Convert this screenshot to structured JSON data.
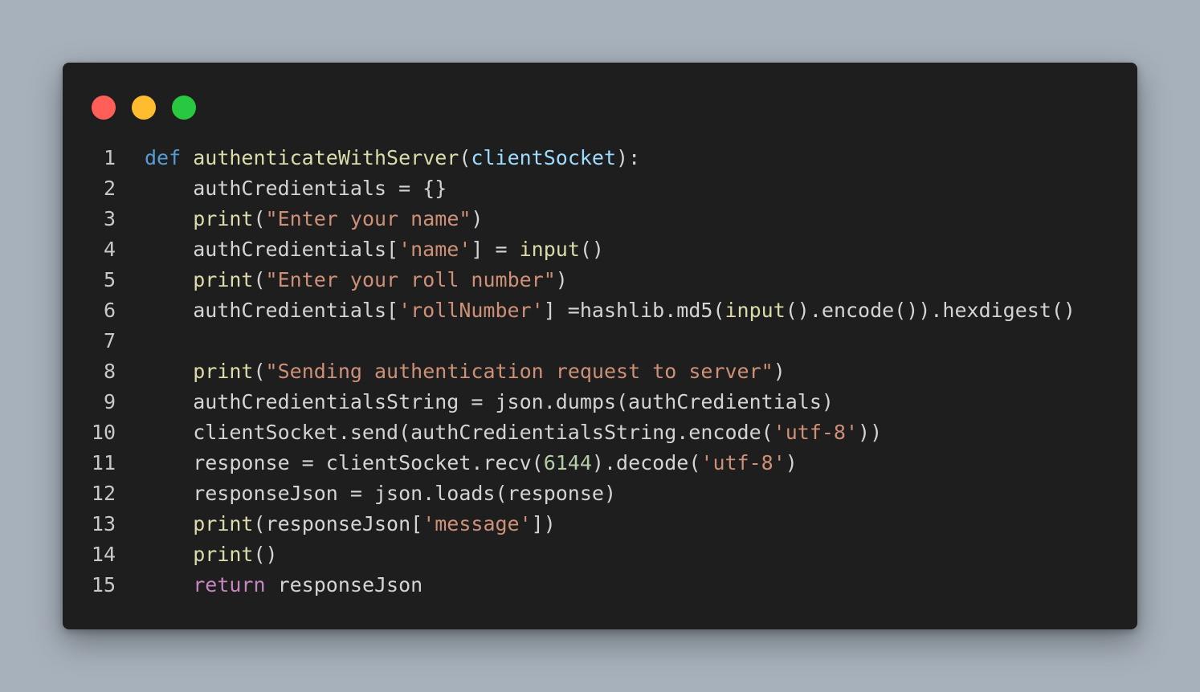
{
  "window": {
    "controls": [
      {
        "name": "close",
        "color": "#ff5f57"
      },
      {
        "name": "minimize",
        "color": "#febc2e"
      },
      {
        "name": "maximize",
        "color": "#28c840"
      }
    ]
  },
  "editor": {
    "language": "python",
    "lines": [
      {
        "num": "1",
        "tokens": [
          {
            "t": "kw",
            "v": "def"
          },
          {
            "t": "plain",
            "v": " "
          },
          {
            "t": "fn",
            "v": "authenticateWithServer"
          },
          {
            "t": "plain",
            "v": "("
          },
          {
            "t": "param",
            "v": "clientSocket"
          },
          {
            "t": "plain",
            "v": "):"
          }
        ]
      },
      {
        "num": "2",
        "tokens": [
          {
            "t": "plain",
            "v": "    authCredientials = {}"
          }
        ]
      },
      {
        "num": "3",
        "tokens": [
          {
            "t": "plain",
            "v": "    "
          },
          {
            "t": "fn",
            "v": "print"
          },
          {
            "t": "plain",
            "v": "("
          },
          {
            "t": "str",
            "v": "\"Enter your name\""
          },
          {
            "t": "plain",
            "v": ")"
          }
        ]
      },
      {
        "num": "4",
        "tokens": [
          {
            "t": "plain",
            "v": "    authCredientials["
          },
          {
            "t": "str",
            "v": "'name'"
          },
          {
            "t": "plain",
            "v": "] = "
          },
          {
            "t": "fn",
            "v": "input"
          },
          {
            "t": "plain",
            "v": "()"
          }
        ]
      },
      {
        "num": "5",
        "tokens": [
          {
            "t": "plain",
            "v": "    "
          },
          {
            "t": "fn",
            "v": "print"
          },
          {
            "t": "plain",
            "v": "("
          },
          {
            "t": "str",
            "v": "\"Enter your roll number\""
          },
          {
            "t": "plain",
            "v": ")"
          }
        ]
      },
      {
        "num": "6",
        "tokens": [
          {
            "t": "plain",
            "v": "    authCredientials["
          },
          {
            "t": "str",
            "v": "'rollNumber'"
          },
          {
            "t": "plain",
            "v": "] =hashlib.md5("
          },
          {
            "t": "fn",
            "v": "input"
          },
          {
            "t": "plain",
            "v": "().encode()).hexdigest()"
          }
        ]
      },
      {
        "num": "7",
        "tokens": []
      },
      {
        "num": "8",
        "tokens": [
          {
            "t": "plain",
            "v": "    "
          },
          {
            "t": "fn",
            "v": "print"
          },
          {
            "t": "plain",
            "v": "("
          },
          {
            "t": "str",
            "v": "\"Sending authentication request to server\""
          },
          {
            "t": "plain",
            "v": ")"
          }
        ]
      },
      {
        "num": "9",
        "tokens": [
          {
            "t": "plain",
            "v": "    authCredientialsString = json.dumps(authCredientials)"
          }
        ]
      },
      {
        "num": "10",
        "tokens": [
          {
            "t": "plain",
            "v": "    clientSocket.send(authCredientialsString.encode("
          },
          {
            "t": "str",
            "v": "'utf-8'"
          },
          {
            "t": "plain",
            "v": "))"
          }
        ]
      },
      {
        "num": "11",
        "tokens": [
          {
            "t": "plain",
            "v": "    response = clientSocket.recv("
          },
          {
            "t": "num",
            "v": "6144"
          },
          {
            "t": "plain",
            "v": ").decode("
          },
          {
            "t": "str",
            "v": "'utf-8'"
          },
          {
            "t": "plain",
            "v": ")"
          }
        ]
      },
      {
        "num": "12",
        "tokens": [
          {
            "t": "plain",
            "v": "    responseJson = json.loads(response)"
          }
        ]
      },
      {
        "num": "13",
        "tokens": [
          {
            "t": "plain",
            "v": "    "
          },
          {
            "t": "fn",
            "v": "print"
          },
          {
            "t": "plain",
            "v": "(responseJson["
          },
          {
            "t": "str",
            "v": "'message'"
          },
          {
            "t": "plain",
            "v": "])"
          }
        ]
      },
      {
        "num": "14",
        "tokens": [
          {
            "t": "plain",
            "v": "    "
          },
          {
            "t": "fn",
            "v": "print"
          },
          {
            "t": "plain",
            "v": "()"
          }
        ]
      },
      {
        "num": "15",
        "tokens": [
          {
            "t": "plain",
            "v": "    "
          },
          {
            "t": "ctrl",
            "v": "return"
          },
          {
            "t": "plain",
            "v": " responseJson"
          }
        ]
      }
    ]
  }
}
